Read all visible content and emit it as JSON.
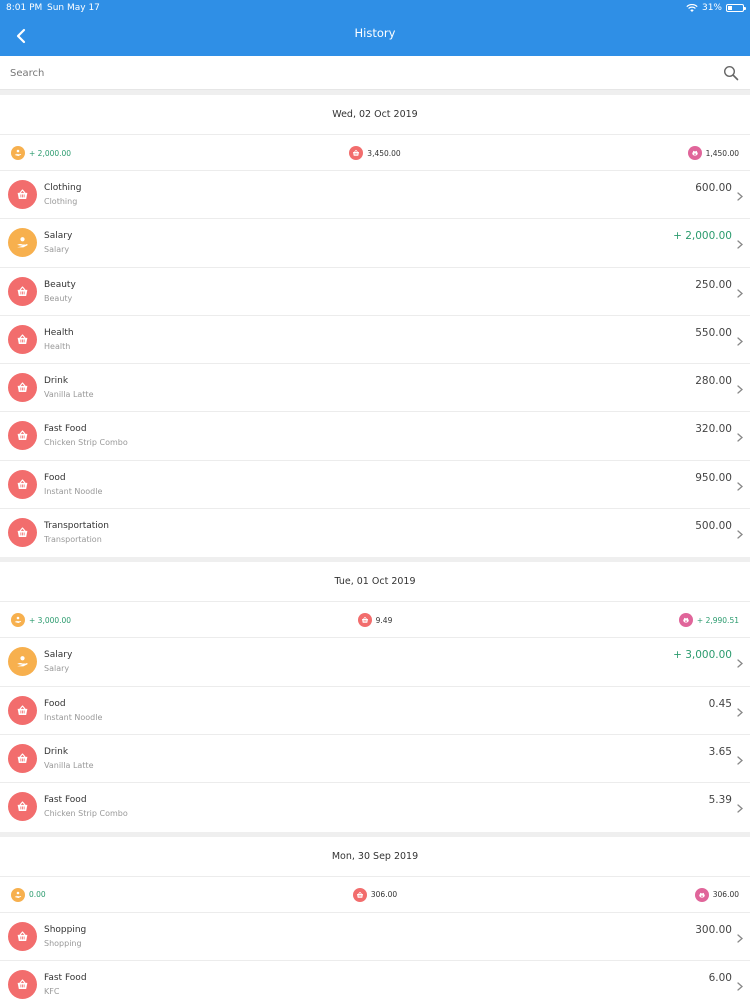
{
  "status_bar": {
    "time": "8:01 PM",
    "date": "Sun May 17",
    "battery": "31%",
    "battery_level": 0.31
  },
  "header": {
    "title": "History"
  },
  "search": {
    "placeholder": "Search"
  },
  "colors": {
    "accent": "#2f8fe6",
    "expense": "#f26d6d",
    "income": "#f7b04e",
    "balance": "#e0659a",
    "positive": "#2b9b6e"
  },
  "days": [
    {
      "date": "Wed, 02 Oct 2019",
      "income": "+ 2,000.00",
      "expense": "3,450.00",
      "balance": "1,450.00",
      "balance_positive": false,
      "items": [
        {
          "category": "Clothing",
          "note": "Clothing",
          "amount": "600.00",
          "type": "expense"
        },
        {
          "category": "Salary",
          "note": "Salary",
          "amount": "+ 2,000.00",
          "type": "income"
        },
        {
          "category": "Beauty",
          "note": "Beauty",
          "amount": "250.00",
          "type": "expense"
        },
        {
          "category": "Health",
          "note": "Health",
          "amount": "550.00",
          "type": "expense"
        },
        {
          "category": "Drink",
          "note": "Vanilla Latte",
          "amount": "280.00",
          "type": "expense"
        },
        {
          "category": "Fast Food",
          "note": "Chicken Strip Combo",
          "amount": "320.00",
          "type": "expense"
        },
        {
          "category": "Food",
          "note": "Instant Noodle",
          "amount": "950.00",
          "type": "expense"
        },
        {
          "category": "Transportation",
          "note": "Transportation",
          "amount": "500.00",
          "type": "expense"
        }
      ]
    },
    {
      "date": "Tue, 01 Oct 2019",
      "income": "+ 3,000.00",
      "expense": "9.49",
      "balance": "+ 2,990.51",
      "balance_positive": true,
      "items": [
        {
          "category": "Salary",
          "note": "Salary",
          "amount": "+ 3,000.00",
          "type": "income"
        },
        {
          "category": "Food",
          "note": "Instant Noodle",
          "amount": "0.45",
          "type": "expense"
        },
        {
          "category": "Drink",
          "note": "Vanilla Latte",
          "amount": "3.65",
          "type": "expense"
        },
        {
          "category": "Fast Food",
          "note": "Chicken Strip Combo",
          "amount": "5.39",
          "type": "expense"
        }
      ]
    },
    {
      "date": "Mon, 30 Sep 2019",
      "income": "0.00",
      "expense": "306.00",
      "balance": "306.00",
      "balance_positive": false,
      "items": [
        {
          "category": "Shopping",
          "note": "Shopping",
          "amount": "300.00",
          "type": "expense"
        },
        {
          "category": "Fast Food",
          "note": "KFC",
          "amount": "6.00",
          "type": "expense"
        }
      ]
    }
  ]
}
